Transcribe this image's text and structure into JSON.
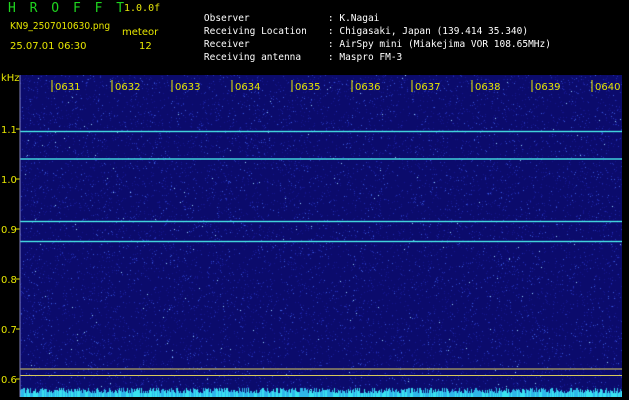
{
  "header": {
    "app_name": "H R O F F T",
    "version": "1.0.0f",
    "filename": "KN9_2507010630.png",
    "mode_label": "meteor",
    "timestamp": "25.07.01 06:30",
    "count": "12"
  },
  "info": [
    {
      "label": "Observer",
      "value": "K.Nagai"
    },
    {
      "label": "Receiving Location",
      "value": "Chigasaki, Japan (139.414 35.340)"
    },
    {
      "label": "Receiver",
      "value": "AirSpy mini (Miakejima VOR 108.65MHz)"
    },
    {
      "label": "Receiving antenna",
      "value": "Maspro FM-3"
    }
  ],
  "axis": {
    "y_unit": "kHz",
    "y_ticks": [
      "1.1",
      "1.0",
      "0.9",
      "0.8",
      "0.7",
      "0.6"
    ],
    "x_ticks": [
      "0631",
      "0632",
      "0633",
      "0634",
      "0635",
      "0636",
      "0637",
      "0638",
      "0639",
      "0640"
    ]
  },
  "chart_data": {
    "type": "heatmap",
    "ylabel": "kHz",
    "ylim": [
      0.58,
      1.16
    ],
    "x_ticks": [
      "0631",
      "0632",
      "0633",
      "0634",
      "0635",
      "0636",
      "0637",
      "0638",
      "0639",
      "0640"
    ],
    "carrier_lines_khz": [
      1.095,
      1.04,
      0.915,
      0.875
    ],
    "marker_lines_khz": [
      0.62,
      0.607
    ]
  },
  "colors": {
    "app_name": "#1fd51f",
    "version": "#e7e70a",
    "text": "#e7e700",
    "info": "#ffffff",
    "background": "#0b0b6c",
    "carrier": "#46e6e6",
    "marker": "#d7c95a"
  }
}
